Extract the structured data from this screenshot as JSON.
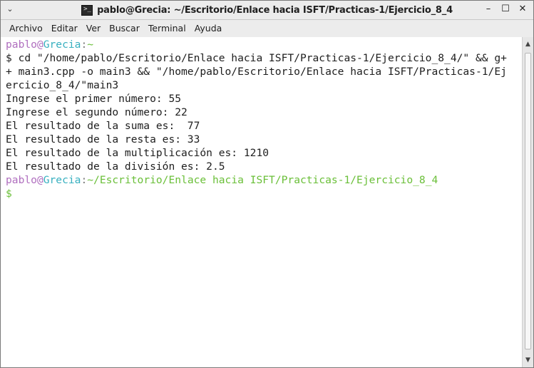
{
  "window": {
    "title": "pablo@Grecia: ~/Escritorio/Enlace hacia ISFT/Practicas-1/Ejercicio_8_4",
    "app_icon_glyph": ">_",
    "menu_button_glyph": "⌄",
    "minimize_glyph": "–",
    "maximize_glyph": "☐",
    "close_glyph": "✕"
  },
  "menu": {
    "items": [
      "Archivo",
      "Editar",
      "Ver",
      "Buscar",
      "Terminal",
      "Ayuda"
    ]
  },
  "terminal": {
    "prompt1": {
      "user": "pablo",
      "at": "@",
      "host": "Grecia",
      "colon": ":",
      "path": "~"
    },
    "command_lines": [
      "$ cd \"/home/pablo/Escritorio/Enlace hacia ISFT/Practicas-1/Ejercicio_8_4/\" && g+",
      "+ main3.cpp -o main3 && \"/home/pablo/Escritorio/Enlace hacia ISFT/Practicas-1/Ej",
      "ercicio_8_4/\"main3"
    ],
    "output_lines": [
      "Ingrese el primer número: 55",
      "Ingrese el segundo número: 22",
      "El resultado de la suma es:  77",
      "El resultado de la resta es: 33",
      "El resultado de la multiplicación es: 1210",
      "El resultado de la división es: 2.5"
    ],
    "prompt2": {
      "user": "pablo",
      "at": "@",
      "host": "Grecia",
      "colon": ":",
      "path": "~/Escritorio/Enlace hacia ISFT/Practicas-1/Ejercicio_8_4"
    },
    "final_prompt": "$"
  },
  "scrollbar": {
    "up_glyph": "▲",
    "down_glyph": "▼"
  },
  "colors": {
    "user": "#b06fbf",
    "host": "#38b0c0",
    "path": "#6abf38",
    "text": "#1e1e1e",
    "background": "#ffffff"
  }
}
